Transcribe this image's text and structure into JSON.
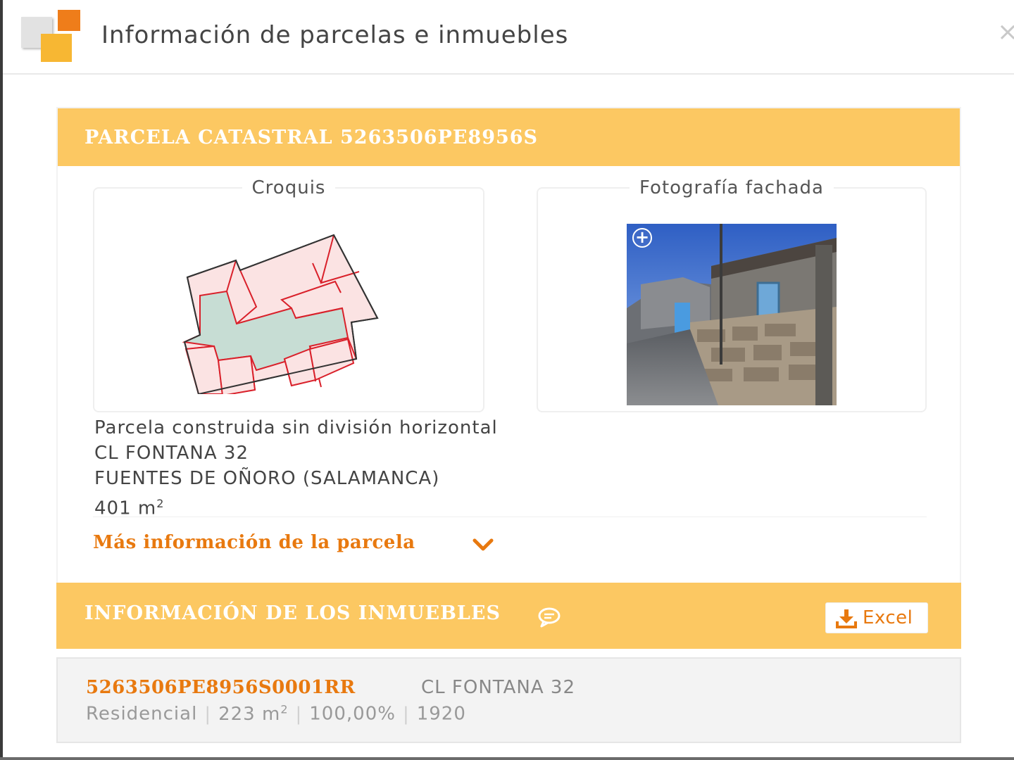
{
  "modal": {
    "title": "Información de parcelas e inmuebles",
    "close_label": "×"
  },
  "parcel": {
    "header_title": "PARCELA CATASTRAL 5263506PE8956S",
    "croquis_label": "Croquis",
    "photo_label": "Fotografía fachada",
    "zoom_label": "+",
    "type": "Parcela construida sin división horizontal",
    "address": "CL FONTANA 32",
    "municipality": "FUENTES DE OÑORO (SALAMANCA)",
    "area_value": "401 m",
    "area_unit_sup": "2",
    "more_info_label": "Más información de la parcela"
  },
  "units": {
    "header_title": "INFORMACIÓN DE LOS INMUEBLES",
    "excel_label": "Excel",
    "items": [
      {
        "reference": "5263506PE8956S0001RR",
        "address": "CL FONTANA 32",
        "use": "Residencial",
        "area_value": "223 m",
        "area_unit_sup": "2",
        "participation": "100,00%",
        "year": "1920"
      }
    ]
  },
  "colors": {
    "accent_orange": "#e8790f",
    "header_yellow": "#fcc862",
    "plot_pink": "#fbe3e3",
    "plot_green": "#c7ddd4",
    "plot_red_line": "#d9202a"
  },
  "icons": [
    "app-logo",
    "close-icon",
    "zoom-in-icon",
    "chevron-down-icon",
    "comment-icon",
    "download-icon"
  ]
}
